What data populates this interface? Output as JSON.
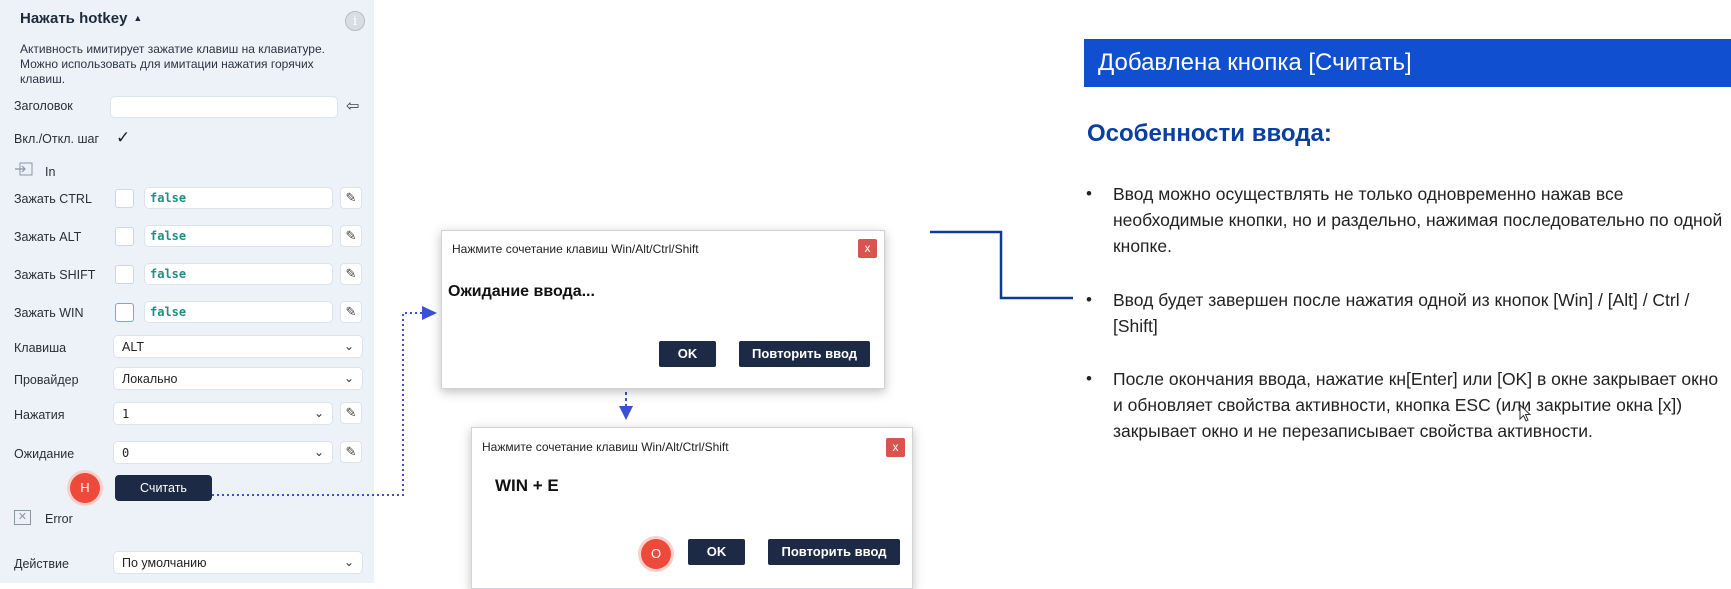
{
  "panel": {
    "title": "Нажать hotkey",
    "description": "Активность имитирует зажатие клавиш на клавиатуре. Можно использовать для имитации нажатия горячих клавиш.",
    "header_label": "Заголовок",
    "header_value": "",
    "toggle_label": "Вкл./Откл. шаг",
    "toggle_checked": true,
    "in_label": "In",
    "ctrl_label": "Зажать CTRL",
    "ctrl_value": "false",
    "alt_label": "Зажать ALT",
    "alt_value": "false",
    "shift_label": "Зажать SHIFT",
    "shift_value": "false",
    "win_label": "Зажать WIN",
    "win_value": "false",
    "key_label": "Клавиша",
    "key_value": "ALT",
    "provider_label": "Провайдер",
    "provider_value": "Локально",
    "presses_label": "Нажатия",
    "presses_value": "1",
    "wait_label": "Ожидание",
    "wait_value": "0",
    "read_button": "Считать",
    "badge_h": "Н",
    "error_label": "Error",
    "action_label": "Действие",
    "action_value": "По умолчанию"
  },
  "dialog1": {
    "title": "Нажмите сочетание клавиш Win/Alt/Ctrl/Shift",
    "close": "x",
    "message": "Ожидание ввода...",
    "ok": "OK",
    "retry": "Повторить ввод"
  },
  "dialog2": {
    "title": "Нажмите сочетание клавиш Win/Alt/Ctrl/Shift",
    "close": "x",
    "message": "WIN + E",
    "ok": "OK",
    "retry": "Повторить ввод",
    "badge_o": "О"
  },
  "slide": {
    "banner": "Добавлена кнопка [Считать]",
    "heading": "Особенности ввода:",
    "bullets": [
      "Ввод можно осуществлять не только одновременно нажав все необходимые кнопки, но и раздельно, нажимая последовательно по одной кнопке.",
      "Ввод будет завершен после нажатия одной из кнопок [Win] / [Alt] / Ctrl / [Shift]",
      "После окончания ввода, нажатие кн[Enter] или [OK] в окне закрывает окно и обновляет свойства активности, кнопка ESC (или закрытие окна [x]) закрывает окно и не перезаписывает свойства активности."
    ]
  },
  "colors": {
    "banner": "#0f4fd0",
    "heading": "#0a3fa0",
    "button": "#1c2a45",
    "badge": "#ee4a3c",
    "connector_dotted": "#3a50d6",
    "connector_line": "#0d3a9a"
  }
}
